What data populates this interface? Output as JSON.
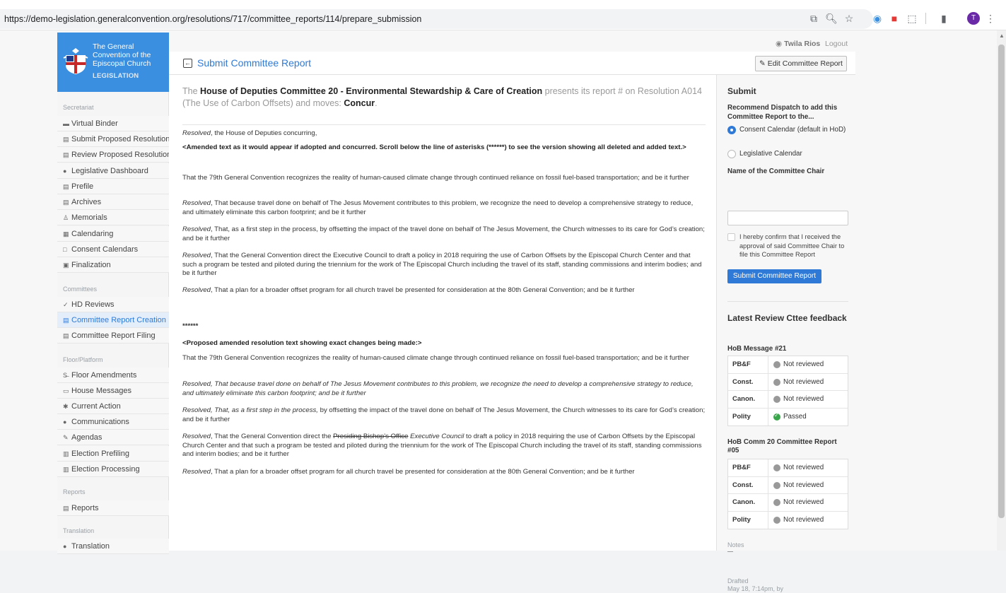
{
  "browser": {
    "url": "https://demo-legislation.generalconvention.org/resolutions/717/committee_reports/114/prepare_submission",
    "profile_initial": "T"
  },
  "user": {
    "name": "Twila Rios",
    "logout": "Logout"
  },
  "brand": {
    "name": "The General Convention of the Episcopal Church",
    "sub": "LEGISLATION"
  },
  "sidebar": {
    "sections": {
      "secretariat": "Secretariat",
      "committees": "Committees",
      "floor": "Floor/Platform",
      "reports": "Reports",
      "translation": "Translation"
    },
    "items": [
      "Virtual Binder",
      "Submit Proposed Resolutions",
      "Review Proposed Resolutions",
      "Legislative Dashboard",
      "Prefile",
      "Archives",
      "Memorials",
      "Calendaring",
      "Consent Calendars",
      "Finalization",
      "HD Reviews",
      "Committee Report Creation",
      "Committee Report Filing",
      "Floor Amendments",
      "House Messages",
      "Current Action",
      "Communications",
      "Agendas",
      "Election Prefiling",
      "Election Processing",
      "Reports",
      "Translation"
    ]
  },
  "header": {
    "title": "Submit Committee Report",
    "edit_label": "Edit Committee Report"
  },
  "intro": {
    "p1": "The ",
    "committee": "House of Deputies Committee 20 - Environmental Stewardship & Care of Creation",
    "p2": " presents its report # on Resolution A014 (The Use of Carbon Offsets) and moves: ",
    "motion": "Concur",
    "p3": "."
  },
  "body": {
    "resolved_opening_it": "Resolved",
    "resolved_opening_rest": ", the House of Deputies concurring,",
    "amended_note": "<Amended text as it would appear if adopted and concurred. Scroll below the line of asterisks (******) to see the version showing all deleted and added text.>",
    "para1": "That the 79th General Convention recognizes the reality of human-caused climate change through continued reliance on fossil fuel-based transportation; and be it further",
    "para2_rest": ", That because travel done on behalf of The Jesus Movement contributes to this problem, we recognize the need to develop a comprehensive strategy to reduce, and ultimately eliminate this carbon footprint; and be it further",
    "para3_rest": ", That, as a first step in the process, by offsetting the impact of the travel done on behalf of The Jesus Movement, the Church witnesses to its care for God’s creation; and be it further",
    "para4_rest": ", That the General Convention direct the Executive Council to draft a policy in 2018 requiring the use of Carbon Offsets by the Episcopal Church Center and that such a program be tested and piloted during the triennium for the work of The Episcopal Church including the travel of its staff, standing commissions and interim bodies; and be it further",
    "para5_rest": ", That a plan for a broader offset program for all church travel be presented for consideration at the 80th General Convention; and be it further",
    "asterisks": "******",
    "proposed_note": "<Proposed amended resolution text showing exact changes being made:>",
    "c1": "That the 79th General Convention recognizes the reality of human-caused climate change through continued reliance on fossil fuel-based transportation; and be it further",
    "c2_a": "Resolved",
    "c2_b": ", That because travel done on behalf of The Jesus Movement contributes to this problem, we recognize the need to develop a comprehensive strategy to reduce, and ultimately eliminate this carbon footprint; and be it further",
    "c3_a": "Resolved, That, as a first step in the process,",
    "c3_b": " by offsetting the impact of the travel done on behalf of The Jesus Movement, the Church witnesses to its care for God’s creation; and be it further",
    "c4_a": "Resolved",
    "c4_b": ", That the General Convention direct the ",
    "c4_del": "Presiding Bishop’s Office",
    "c4_ins": " Executive Council",
    "c4_c": " to draft a policy in 2018 requiring the use of Carbon Offsets by the Episcopal Church Center and that such a program be tested and piloted during the triennium for the work of The Episcopal Church including the travel of its staff, standing commissions and interim bodies; and be it further",
    "c5_a": "Resolved",
    "c5_b": ", That a plan for a broader offset program for all church travel be presented for consideration at the 80th General Convention; and be it further"
  },
  "submit": {
    "title": "Submit",
    "recommend": "Recommend Dispatch to add this Committee Report to the...",
    "opt_consent": "Consent Calendar (default in HoD)",
    "opt_legislative": "Legislative Calendar",
    "chair_label": "Name of the Committee Chair",
    "chair_value": "",
    "confirm_text": "I hereby confirm that I received the approval of said Committee Chair to file this Committee Report",
    "button": "Submit Committee Report"
  },
  "feedback": {
    "title": "Latest Review Cttee feedback",
    "groups": [
      {
        "title": "HoB Message #21",
        "rows": [
          {
            "key": "PB&F",
            "status": "Not reviewed",
            "ok": false
          },
          {
            "key": "Const.",
            "status": "Not reviewed",
            "ok": false
          },
          {
            "key": "Canon.",
            "status": "Not reviewed",
            "ok": false
          },
          {
            "key": "Polity",
            "status": "Passed",
            "ok": true
          }
        ]
      },
      {
        "title": "HoB Comm 20 Committee Report #05",
        "rows": [
          {
            "key": "PB&F",
            "status": "Not reviewed",
            "ok": false
          },
          {
            "key": "Const.",
            "status": "Not reviewed",
            "ok": false
          },
          {
            "key": "Canon.",
            "status": "Not reviewed",
            "ok": false
          },
          {
            "key": "Polity",
            "status": "Not reviewed",
            "ok": false
          }
        ]
      }
    ],
    "notes_label": "Notes",
    "drafted_label": "Drafted",
    "drafted_value": "May 18, 7:14pm, by"
  }
}
